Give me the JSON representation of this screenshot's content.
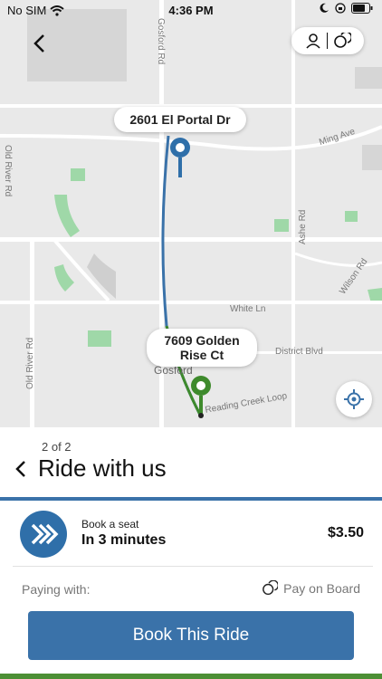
{
  "status": {
    "carrier": "No SIM",
    "time": "4:36 PM"
  },
  "map": {
    "streets": [
      "Gosford Rd",
      "Ming Ave",
      "Old River Rd",
      "Ashe Rd",
      "Wilson Rd",
      "White Ln",
      "District Blvd",
      "Old River Rd",
      "Reading Creek Loop",
      "Gosford"
    ],
    "origin_label": "2601 El Portal Dr",
    "destination_label": "7609 Golden Rise Ct"
  },
  "sheet": {
    "step": "2 of 2",
    "title": "Ride with us",
    "option": {
      "label": "Book a seat",
      "time": "In 3 minutes",
      "price": "$3.50"
    },
    "paying_with_label": "Paying with:",
    "payment_method": "Pay on Board",
    "book_button": "Book This Ride"
  },
  "colors": {
    "accent": "#3a72a9",
    "route_blue": "#2f6fa9",
    "route_green": "#3e8a2c",
    "map_bg": "#e9e9e9"
  },
  "icons": [
    "back-icon",
    "profile-icon",
    "payment-icon",
    "locate-icon",
    "wifi-icon",
    "battery-icon"
  ]
}
